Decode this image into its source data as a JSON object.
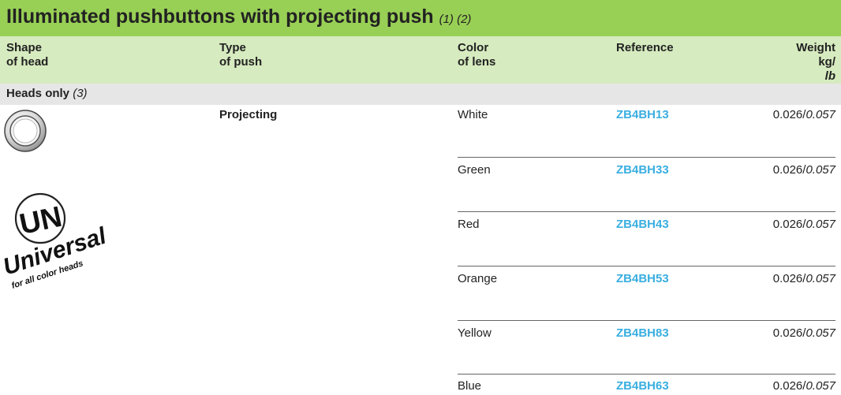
{
  "title": {
    "main": "Illuminated pushbuttons with projecting push",
    "notes": "(1) (2)"
  },
  "headers": {
    "shape": [
      "Shape",
      "of head"
    ],
    "type": [
      "Type",
      "of push"
    ],
    "color": [
      "Color",
      "of lens"
    ],
    "reference": "Reference",
    "weight": [
      "Weight",
      "kg/",
      "lb"
    ]
  },
  "section": {
    "label": "Heads only",
    "note": "(3)"
  },
  "type_of_push": "Projecting",
  "logo": {
    "big": "UN",
    "word": "Universal",
    "sub": "for all color heads"
  },
  "rows": [
    {
      "color": "White",
      "ref": "ZB4BH13",
      "weight_kg": "0.026/",
      "weight_lb": "0.057"
    },
    {
      "color": "Green",
      "ref": "ZB4BH33",
      "weight_kg": "0.026/",
      "weight_lb": "0.057"
    },
    {
      "color": "Red",
      "ref": "ZB4BH43",
      "weight_kg": "0.026/",
      "weight_lb": "0.057"
    },
    {
      "color": "Orange",
      "ref": "ZB4BH53",
      "weight_kg": "0.026/",
      "weight_lb": "0.057"
    },
    {
      "color": "Yellow",
      "ref": "ZB4BH83",
      "weight_kg": "0.026/",
      "weight_lb": "0.057"
    },
    {
      "color": "Blue",
      "ref": "ZB4BH63",
      "weight_kg": "0.026/",
      "weight_lb": "0.057"
    }
  ],
  "colors": {
    "title_bg": "#98cf55",
    "header_bg": "#d6ebbf",
    "section_bg": "#e6e6e6",
    "ref": "#3aaee0"
  }
}
